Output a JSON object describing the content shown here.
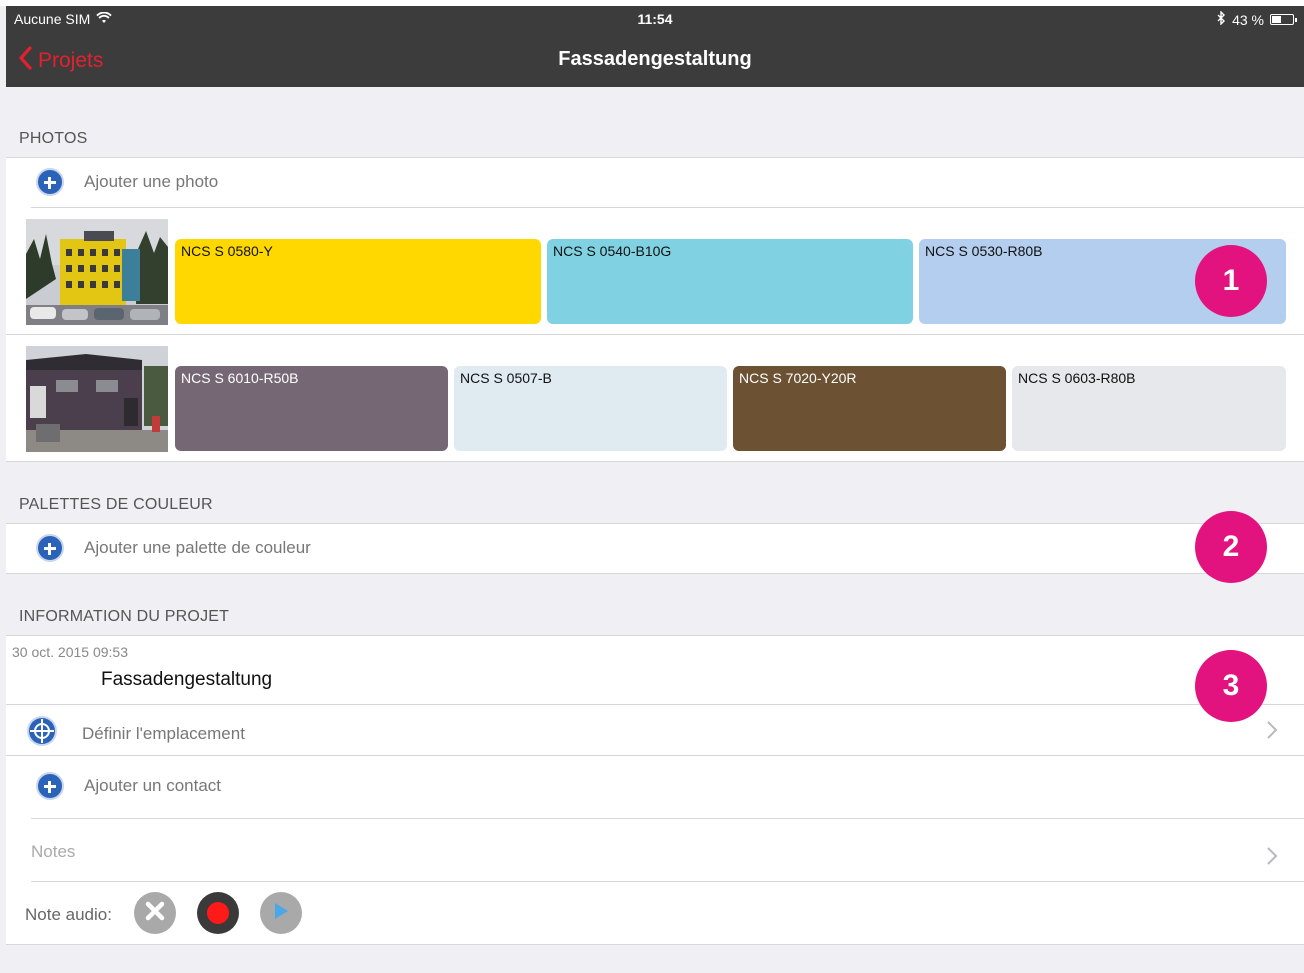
{
  "status_bar": {
    "carrier": "Aucune SIM",
    "time": "11:54",
    "battery": "43 %",
    "battery_level": 0.43
  },
  "nav": {
    "back_label": "Projets",
    "title": "Fassadengestaltung"
  },
  "photos_section": {
    "header": "PHOTOS",
    "add_label": "Ajouter une photo",
    "rows": [
      {
        "swatches": [
          {
            "label": "NCS S 0580-Y",
            "color": "#ffd800"
          },
          {
            "label": "NCS S 0540-B10G",
            "color": "#80d2e3"
          },
          {
            "label": "NCS S 0530-R80B",
            "color": "#b3ceee"
          }
        ]
      },
      {
        "swatches": [
          {
            "label": "NCS S 6010-R50B",
            "color": "#756874"
          },
          {
            "label": "NCS S 0507-B",
            "color": "#e0eaf1"
          },
          {
            "label": "NCS S 7020-Y20R",
            "color": "#6c5133"
          },
          {
            "label": "NCS S 0603-R80B",
            "color": "#e6e8ec"
          }
        ]
      }
    ]
  },
  "palettes_section": {
    "header": "PALETTES DE COULEUR",
    "add_label": "Ajouter une palette de couleur"
  },
  "project_info": {
    "header": "INFORMATION DU PROJET",
    "date": "30 oct. 2015 09:53",
    "name": "Fassadengestaltung",
    "location_label": "Définir l'emplacement",
    "contact_label": "Ajouter un contact",
    "notes_label": "Notes",
    "audio_label": "Note audio:"
  },
  "badges": [
    "1",
    "2",
    "3"
  ],
  "colors": {
    "accent_red": "#e4202e",
    "badge_pink": "#e2127f",
    "plus_blue": "#2a63b8",
    "nav_bg": "#3c3c3c"
  }
}
